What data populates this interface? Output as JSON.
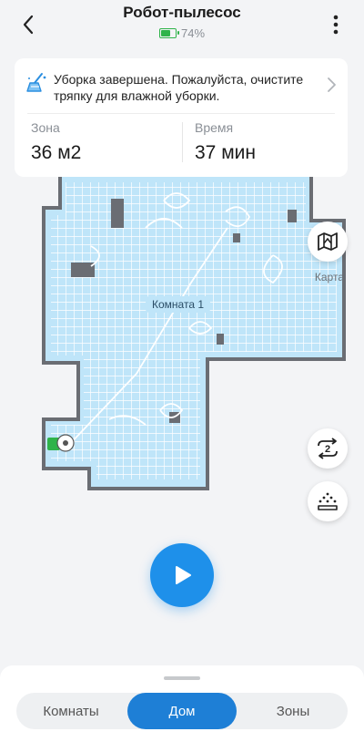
{
  "header": {
    "title": "Робот-пылесос",
    "battery_percent": "74%",
    "battery_level": 0.74
  },
  "notice": {
    "text": "Уборка завершена. Пожалуйста, очистите тряпку для влажной уборки."
  },
  "stats": {
    "zone_label": "Зона",
    "zone_value": "36 м2",
    "time_label": "Время",
    "time_value": "37 мин"
  },
  "map": {
    "room_label": "Комната 1",
    "map_button_label": "Карта"
  },
  "side_buttons": {
    "repeat_count": "2"
  },
  "tabs": {
    "items": [
      {
        "label": "Комнаты",
        "active": false
      },
      {
        "label": "Дом",
        "active": true
      },
      {
        "label": "Зоны",
        "active": false
      }
    ]
  },
  "colors": {
    "accent": "#1e90ea",
    "floor": "#bfe5f9",
    "wall": "#6a6d73",
    "battery": "#2fb34a"
  }
}
